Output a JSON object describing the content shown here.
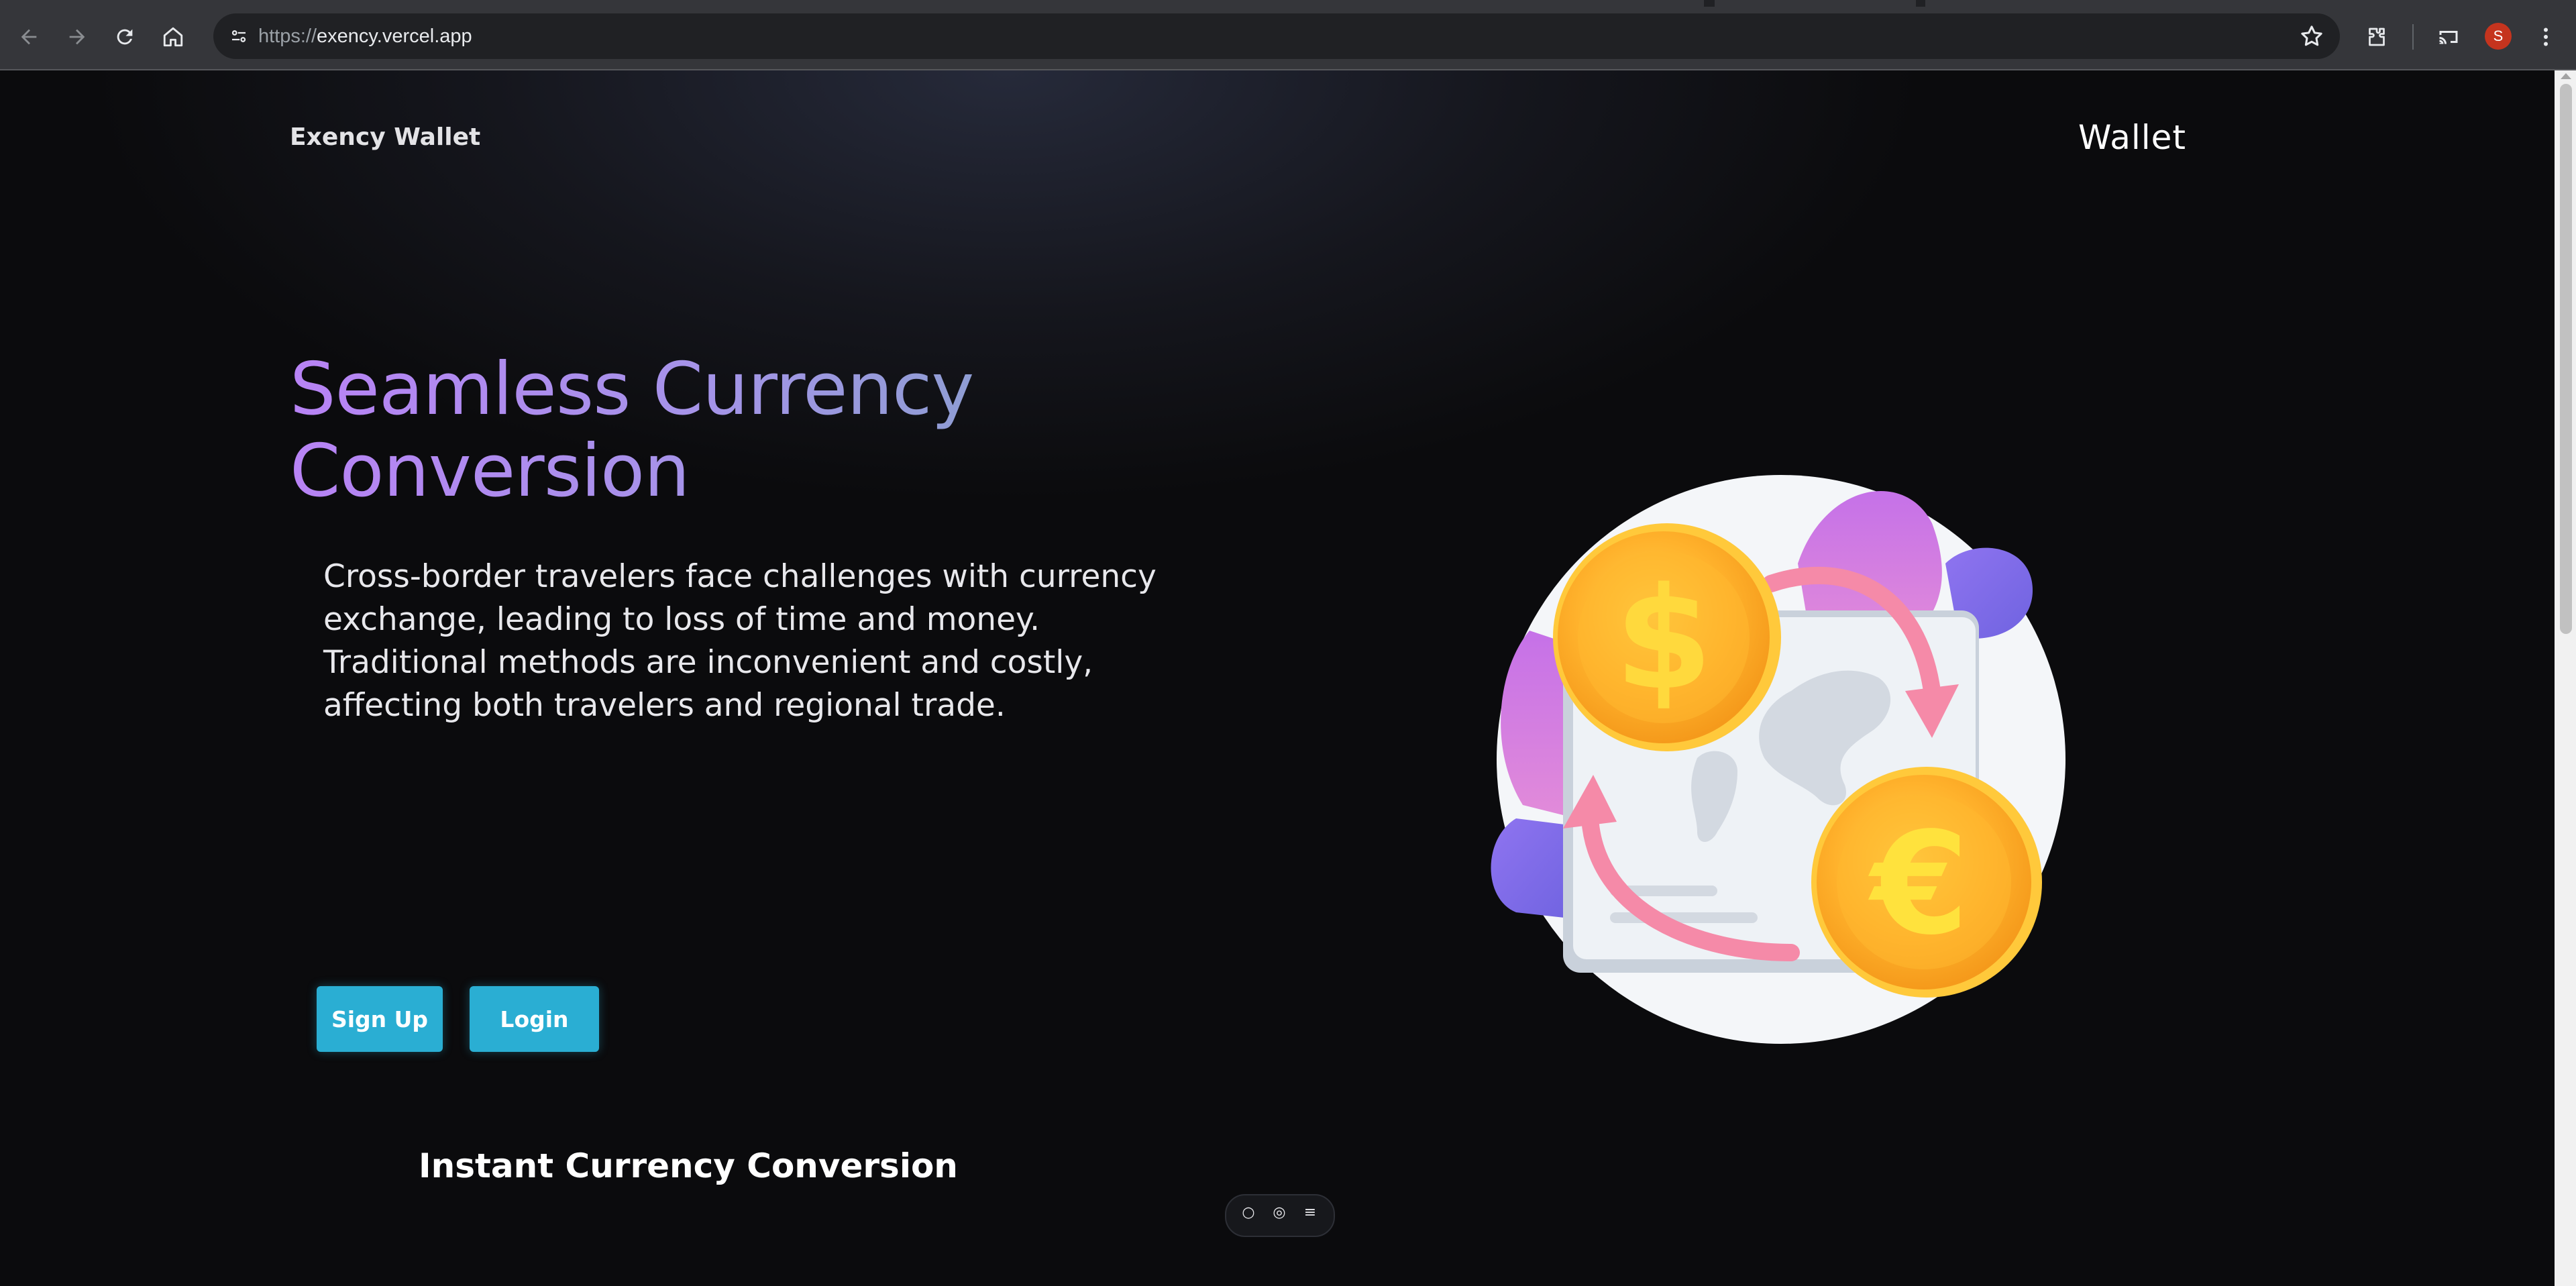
{
  "browser": {
    "url_scheme": "https://",
    "url_host": "exency.vercel.app",
    "profile_initial": "S",
    "icons": [
      "back-icon",
      "forward-icon",
      "reload-icon",
      "home-icon",
      "site-info-icon",
      "bookmark-star-icon",
      "extensions-icon",
      "cast-icon",
      "menu-kebab-icon"
    ]
  },
  "page": {
    "brand": "Exency Wallet",
    "nav_link": "Wallet",
    "hero": {
      "title_line1": "Seamless Currency",
      "title_line2": "Conversion",
      "description": "Cross-border travelers face challenges with currency exchange, leading to loss of time and money. Traditional methods are inconvenient and costly, affecting both travelers and regional trade."
    },
    "buttons": {
      "signup": "Sign Up",
      "login": "Login"
    },
    "section_title": "Instant Currency Conversion",
    "illustration": {
      "icons": [
        "dollar-coin-icon",
        "euro-coin-icon",
        "exchange-arrows-icon",
        "world-map-card-icon"
      ],
      "coin_symbols": [
        "$",
        "€"
      ]
    }
  },
  "colors": {
    "accent_button": "#2aaed3",
    "title_gradient_start": "#b883f5",
    "title_gradient_end": "#8a9fcf",
    "background": "#0b0b0d"
  }
}
